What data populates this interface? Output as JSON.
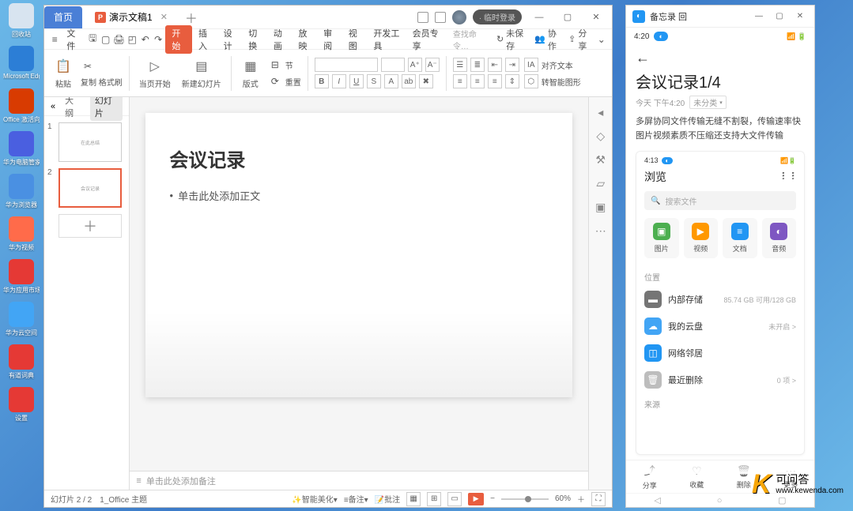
{
  "desktop": {
    "icons": [
      {
        "label": "回收站",
        "bg": "#d8e4f0"
      },
      {
        "label": "Microsoft Edge",
        "bg": "#2c7ed6"
      },
      {
        "label": "Office 激活向导",
        "bg": "#d83b01"
      },
      {
        "label": "华为电脑管家",
        "bg": "#4a5fe0"
      },
      {
        "label": "华为浏览器",
        "bg": "#4a90e2"
      },
      {
        "label": "华为视频",
        "bg": "#ff6b4a"
      },
      {
        "label": "华为应用市场",
        "bg": "#e53935"
      },
      {
        "label": "华为云空间",
        "bg": "#42a5f5"
      },
      {
        "label": "有道词典",
        "bg": "#e53935"
      },
      {
        "label": "设置",
        "bg": "#e53935"
      }
    ]
  },
  "wps": {
    "home_tab": "首页",
    "doc_tab": "演示文稿1",
    "login_pill": "· 临时登录",
    "menus": [
      "开始",
      "插入",
      "设计",
      "切换",
      "动画",
      "放映",
      "审阅",
      "视图",
      "开发工具",
      "会员专享"
    ],
    "search_placeholder": "查找命令…",
    "actions": {
      "unsave": "未保存",
      "collab": "协作",
      "share": "分享"
    },
    "file_menu": "文件",
    "toolbar": {
      "paste": "粘贴",
      "paste_sub": "复制 格式刷",
      "start": "当页开始",
      "newslide": "新建幻灯片",
      "layout": "版式",
      "section": "节",
      "reset": "重置",
      "text_tools": "B I U S A",
      "align": "对齐文本",
      "smart_shape": "转智能图形"
    },
    "sidebar": {
      "outline": "大纲",
      "slides": "幻灯片",
      "collapse": "«"
    },
    "slide": {
      "title": "会议记录",
      "bullet": "单击此处添加正文"
    },
    "thumb1": "在此总结",
    "thumb2": "会议记录",
    "notes_placeholder": "单击此处添加备注",
    "status": {
      "page": "幻灯片 2 / 2",
      "theme": "1_Office 主题",
      "beautify": "智能美化",
      "notes": "备注",
      "comments": "批注",
      "zoom": "60%"
    }
  },
  "phone": {
    "window_title": "备忘录 回",
    "time": "4:20",
    "pill": "◐",
    "note_title": "会议记录1/4",
    "note_date": "今天 下午4:20",
    "note_tag": "未分类",
    "note_body_1": "多屏协同文件传输无缝不割裂，传输速率快",
    "note_body_2": "图片视频素质不压缩还支持大文件传输",
    "inner": {
      "time": "4:13",
      "pill": "◐",
      "browse": "浏览",
      "menu": "፧ ፧",
      "search": "搜索文件",
      "cats": [
        {
          "label": "图片",
          "bg": "#4caf50",
          "icon": "▣"
        },
        {
          "label": "视频",
          "bg": "#ff9800",
          "icon": "▶"
        },
        {
          "label": "文档",
          "bg": "#2196f3",
          "icon": "≡"
        },
        {
          "label": "音频",
          "bg": "#7e57c2",
          "icon": "◐"
        }
      ],
      "loc_label": "位置",
      "storage": [
        {
          "name": "内部存储",
          "meta": "85.74 GB 可用/128 GB",
          "bg": "#757575",
          "icon": "▬"
        },
        {
          "name": "我的云盘",
          "meta": "未开启 >",
          "bg": "#42a5f5",
          "icon": "☁"
        },
        {
          "name": "网络邻居",
          "meta": "",
          "bg": "#2196f3",
          "icon": "◫"
        },
        {
          "name": "最近删除",
          "meta": "0 项 >",
          "bg": "#bdbdbd",
          "icon": "🗑"
        }
      ],
      "src_label": "来源"
    },
    "toolbar": [
      {
        "label": "分享",
        "icon": "⤴"
      },
      {
        "label": "收藏",
        "icon": "♡"
      },
      {
        "label": "删除",
        "icon": "🗑"
      },
      {
        "label": "更多",
        "icon": "⋯"
      }
    ]
  },
  "watermark": {
    "cn": "可问答",
    "url": "www.kewenda.com"
  }
}
